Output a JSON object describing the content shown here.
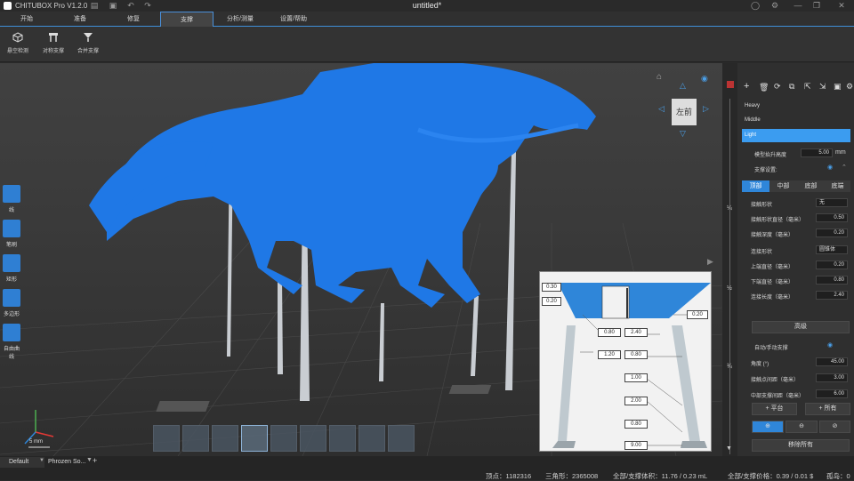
{
  "window": {
    "app_name": "CHITUBOX Pro V1.2.0",
    "doc_title": "untitled*"
  },
  "menu": {
    "tabs": [
      "开始",
      "准备",
      "修复",
      "支撑",
      "分析/测量",
      "设置/帮助"
    ],
    "active": "支撑"
  },
  "toolbar": {
    "tools": [
      {
        "label": "悬空检测",
        "icon": "cube-detect-icon"
      },
      {
        "label": "对称支撑",
        "icon": "symmetric-support-icon"
      },
      {
        "label": "合并支撑",
        "icon": "merge-support-icon"
      }
    ]
  },
  "left_tools": [
    {
      "label": "线",
      "icon": "line-tool-icon"
    },
    {
      "label": "笔刷",
      "icon": "brush-tool-icon"
    },
    {
      "label": "矩形",
      "icon": "rectangle-tool-icon"
    },
    {
      "label": "多边形",
      "icon": "polygon-tool-icon"
    },
    {
      "label": "自由曲线",
      "icon": "freeform-tool-icon"
    }
  ],
  "view_cube": {
    "left": "左",
    "front": "前"
  },
  "scale_label": "5 mm",
  "right_panel": {
    "presets": [
      "Heavy",
      "Middle",
      "Light"
    ],
    "selected_preset": "Light",
    "lift_height_label": "模型抬升高度",
    "lift_height_value": "5.00",
    "lift_height_unit": "mm",
    "support_settings_label": "支撑设置:",
    "subtabs": [
      "顶部",
      "中部",
      "底部",
      "底端"
    ],
    "selected_subtab": "顶部",
    "fields": [
      {
        "label": "接触形状",
        "value": "无"
      },
      {
        "label": "接触形状直径（毫米）",
        "value": "0.50"
      },
      {
        "label": "接触深度（毫米）",
        "value": "0.20"
      },
      {
        "label": "连接形状",
        "value": "圆锥体"
      },
      {
        "label": "上端直径（毫米）",
        "value": "0.20"
      },
      {
        "label": "下端直径（毫米）",
        "value": "0.80"
      },
      {
        "label": "连接长度（毫米）",
        "value": "2.40"
      }
    ],
    "advanced_button": "高级",
    "auto_manual_label": "自动/手动支撑",
    "auto_fields": [
      {
        "label": "角度 (°)",
        "value": "45.00"
      },
      {
        "label": "接触点间距（毫米）",
        "value": "3.00"
      },
      {
        "label": "中部支撑间距（毫米）",
        "value": "6.00"
      }
    ],
    "platform_button": "+ 平台",
    "all_button": "+ 所有",
    "remove_all_button": "移除所有"
  },
  "detail_dims": {
    "top_offset": "0.30",
    "left_depth": "0.20",
    "right_depth": "0.20",
    "d_080a": "0.80",
    "d_240": "2.40",
    "d_120": "1.20",
    "d_080b": "0.80",
    "d_100": "1.00",
    "d_200": "2.00",
    "d_080c": "0.80",
    "d_900": "9.00"
  },
  "file_tabs": [
    "Default",
    "Phrozen So..."
  ],
  "status": {
    "vertices": "顶点：1182316",
    "triangles": "三角形：2365008",
    "volume": "全部/支撑体积：11.76 / 0.23 mL",
    "price": "全部/支撑价格：0.39 / 0.01 $",
    "islands": "孤岛：0"
  },
  "colors": {
    "accent": "#2f86d9",
    "model": "#1f78e6",
    "support": "#c9cdd2"
  }
}
